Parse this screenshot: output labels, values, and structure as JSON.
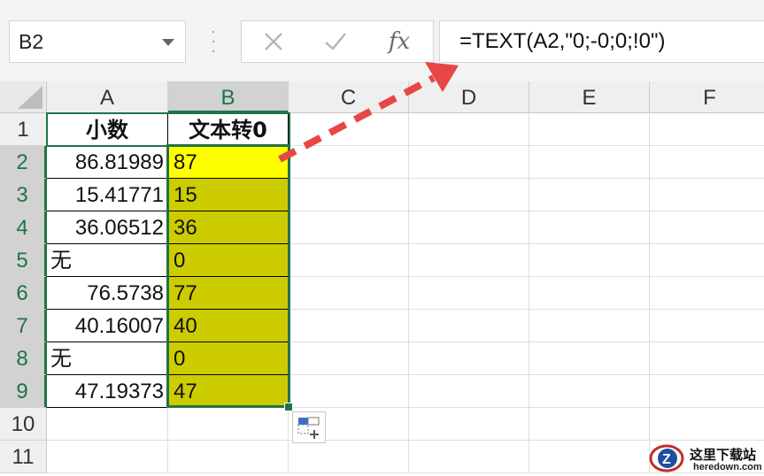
{
  "name_box": {
    "value": "B2"
  },
  "formula_bar": {
    "cancel_icon": "x-icon",
    "enter_icon": "check-icon",
    "fx_label": "fx",
    "formula": "=TEXT(A2,\"0;-0;0;!0\")"
  },
  "columns": [
    "A",
    "B",
    "C",
    "D",
    "E",
    "F"
  ],
  "rows": [
    "1",
    "2",
    "3",
    "4",
    "5",
    "6",
    "7",
    "8",
    "9",
    "10",
    "11"
  ],
  "table": {
    "header_a": "小数",
    "header_b": "文本转0",
    "col_a": [
      "86.81989",
      "15.41771",
      "36.06512",
      "无",
      "76.5738",
      "40.16007",
      "无",
      "47.19373"
    ],
    "col_b": [
      "87",
      "15",
      "36",
      "0",
      "77",
      "40",
      "0",
      "47"
    ]
  },
  "colors": {
    "active_cell": "#ffff00",
    "result_fill": "#cccc00",
    "selection_border": "#217346",
    "arrow": "#e84545"
  },
  "watermark": {
    "title": "这里下载站",
    "subtitle": "heredown.com"
  }
}
